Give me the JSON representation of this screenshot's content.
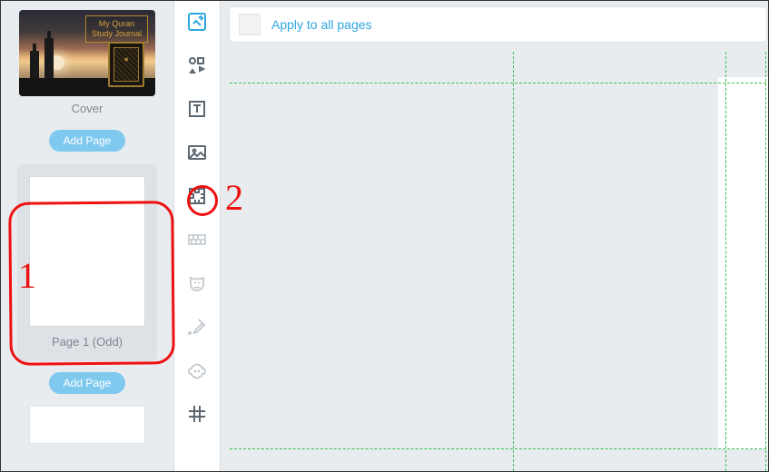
{
  "sidebar": {
    "cover": {
      "title_line1": "My Quran",
      "title_line2": "Study Journal",
      "caption": "Cover"
    },
    "add_page_label": "Add Page",
    "pages": [
      {
        "caption": "Page 1 (Odd)"
      }
    ]
  },
  "toolbar": {
    "items": [
      {
        "name": "edit-icon",
        "active": true
      },
      {
        "name": "shapes-icon"
      },
      {
        "name": "text-icon"
      },
      {
        "name": "image-icon"
      },
      {
        "name": "puzzle-icon"
      },
      {
        "name": "brick-icon",
        "disabled": true
      },
      {
        "name": "mask-icon",
        "disabled": true
      },
      {
        "name": "brush-icon",
        "disabled": true
      },
      {
        "name": "sheep-icon",
        "disabled": true
      },
      {
        "name": "grid-icon"
      }
    ]
  },
  "canvas": {
    "apply_label": "Apply to all pages"
  },
  "annotations": {
    "num1": "1",
    "num2": "2"
  }
}
